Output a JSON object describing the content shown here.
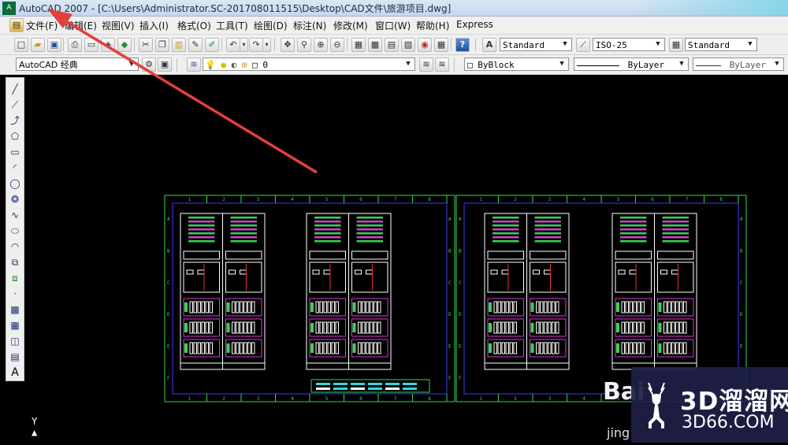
{
  "window": {
    "title": "AutoCAD 2007 - [C:\\Users\\Administrator.SC-201708011515\\Desktop\\CAD文件\\旅游项目.dwg]",
    "app_icon": "autocad-app-icon"
  },
  "menu": [
    {
      "label": "文件(F)"
    },
    {
      "label": "编辑(E)"
    },
    {
      "label": "视图(V)"
    },
    {
      "label": "插入(I)"
    },
    {
      "label": "格式(O)"
    },
    {
      "label": "工具(T)"
    },
    {
      "label": "绘图(D)"
    },
    {
      "label": "标注(N)"
    },
    {
      "label": "修改(M)"
    },
    {
      "label": "窗口(W)"
    },
    {
      "label": "帮助(H)"
    },
    {
      "label": "Express"
    }
  ],
  "toolbar": {
    "text_style": "Standard",
    "dim_style": "ISO-25",
    "table_style": "Standard"
  },
  "properties": {
    "workspace": "AutoCAD 经典",
    "layer": "0",
    "color": "ByBlock",
    "linetype": "ByLayer",
    "lineweight": "ByLayer"
  },
  "left_toolbar": {
    "text_tool_glyph": "A"
  },
  "ucs": {
    "axis_label": "Y"
  },
  "drawing": {
    "column_numbers": [
      "1",
      "2",
      "3",
      "4",
      "5",
      "6",
      "7",
      "8"
    ],
    "row_letters": [
      "A",
      "B",
      "C",
      "D",
      "E",
      "F"
    ]
  },
  "watermark": {
    "name": "3D溜溜网",
    "domain": "3D66.COM",
    "overlay_text_1": "Bai",
    "overlay_text_2": "jing"
  },
  "colors": {
    "frame": "#39d353",
    "inner_frame": "#3a3aff",
    "text_green": "#39d353",
    "magenta": "#d33cd3",
    "red_element": "#e23434",
    "cyan": "#33d6e0",
    "white": "#ffffff",
    "annotation_arrow": "#e2403a"
  }
}
